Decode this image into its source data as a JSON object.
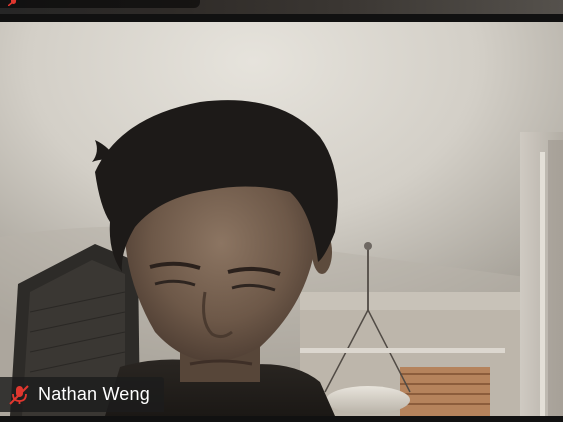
{
  "participants": [
    {
      "name": "",
      "mic_muted": true
    },
    {
      "name": "Nathan Weng",
      "mic_muted": true
    }
  ],
  "icons": {
    "mic": "microphone-muted-icon"
  },
  "colors": {
    "mute_icon": "#e0372f",
    "name_tag_bg": "#1c1c1c",
    "name_text": "#ffffff"
  }
}
